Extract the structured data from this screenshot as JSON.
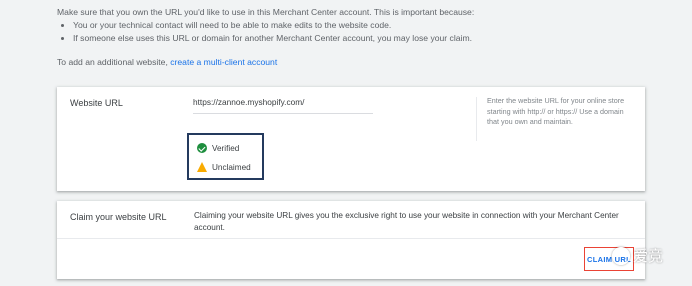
{
  "intro": {
    "heading": "Make sure that you own the URL you'd like to use in this Merchant Center account. This is important because:",
    "bullets": [
      "You or your technical contact will need to be able to make edits to the website code.",
      "If someone else uses this URL or domain for another Merchant Center account, you may lose your claim."
    ]
  },
  "multiclient": {
    "prefix": "To add an additional website, ",
    "link": "create a multi-client account"
  },
  "website_card": {
    "label": "Website URL",
    "url_value": "https://zannoe.myshopify.com/",
    "help": "Enter the website URL for your online store starting with http:// or https:// Use a domain that you own and maintain.",
    "status": [
      {
        "icon": "check-circle-icon",
        "text": "Verified",
        "color": "#1e8e3e"
      },
      {
        "icon": "warning-icon",
        "text": "Unclaimed",
        "color": "#f9ab00"
      }
    ]
  },
  "claim_card": {
    "label": "Claim your website URL",
    "desc": "Claiming your website URL gives you the exclusive right to use your website in connection with your Merchant Center account.",
    "button": "CLAIM URL"
  },
  "watermark": {
    "text": "爱竞"
  }
}
